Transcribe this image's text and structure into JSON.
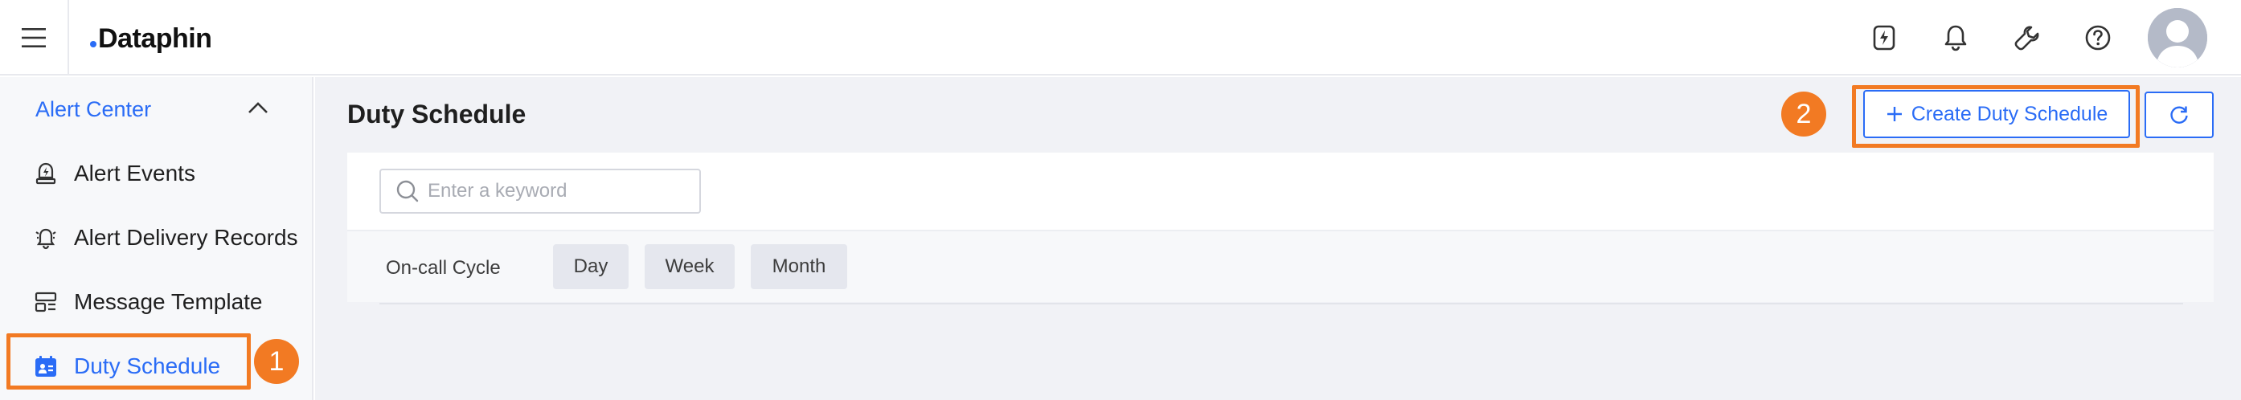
{
  "header": {
    "logo_text": "Dataphin",
    "brand_color": "#2a6cf6",
    "icons": [
      "menu-icon",
      "lightning-icon",
      "bell-icon",
      "wrench-icon",
      "help-icon",
      "user-avatar"
    ]
  },
  "sidebar": {
    "group_label": "Alert Center",
    "group_expanded": true,
    "items": [
      {
        "label": "Alert Events",
        "icon": "alert-event-icon",
        "active": false
      },
      {
        "label": "Alert Delivery Records",
        "icon": "alarm-bell-icon",
        "active": false
      },
      {
        "label": "Message Template",
        "icon": "template-icon",
        "active": false
      },
      {
        "label": "Duty Schedule",
        "icon": "calendar-icon",
        "active": true
      }
    ]
  },
  "annotations": {
    "step1": "1",
    "step2": "2",
    "highlight_color": "#f27a23"
  },
  "main": {
    "title": "Duty Schedule",
    "create_button_label": "Create Duty Schedule",
    "search_placeholder": "Enter a keyword",
    "search_value": "",
    "filter_label": "On-call Cycle",
    "cycle_options": [
      "Day",
      "Week",
      "Month"
    ]
  }
}
